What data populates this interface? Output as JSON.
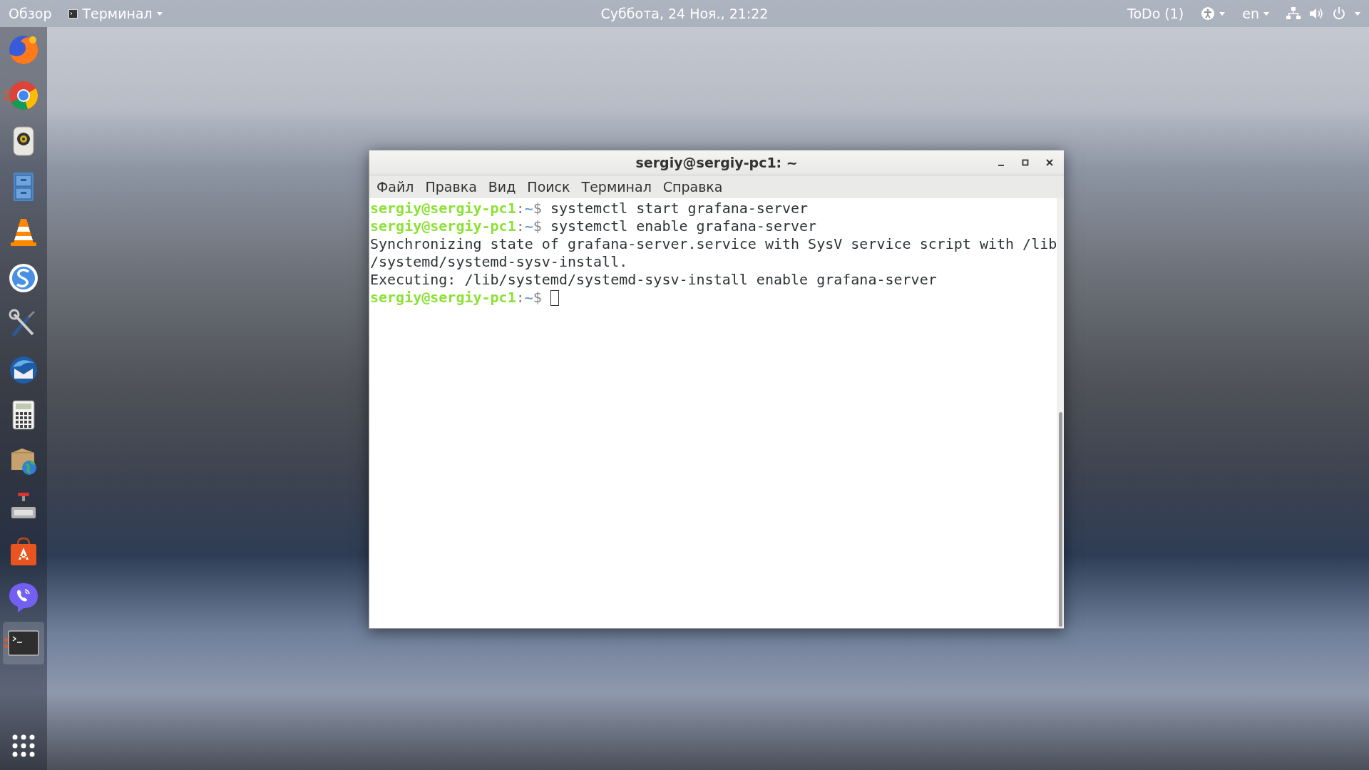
{
  "top_bar": {
    "activities": "Обзор",
    "app_menu": "Терминал",
    "clock": "Суббота, 24 Ноя., 21:22",
    "todo": "ToDo (1)",
    "language": "en"
  },
  "dock": {
    "items": [
      {
        "kind": "globe",
        "running": false,
        "selected": false
      },
      {
        "kind": "ring",
        "running": true,
        "selected": false
      },
      {
        "kind": "speaker",
        "running": false,
        "selected": false
      },
      {
        "kind": "cabinet",
        "running": false,
        "selected": false
      },
      {
        "kind": "cone",
        "running": false,
        "selected": false
      },
      {
        "kind": "swirl",
        "running": false,
        "selected": false
      },
      {
        "kind": "tools",
        "running": false,
        "selected": false
      },
      {
        "kind": "bird",
        "running": false,
        "selected": false
      },
      {
        "kind": "calculator",
        "running": false,
        "selected": false
      },
      {
        "kind": "package",
        "running": false,
        "selected": false
      },
      {
        "kind": "download",
        "running": false,
        "selected": false
      },
      {
        "kind": "bag",
        "running": false,
        "selected": false
      },
      {
        "kind": "phone",
        "running": false,
        "selected": false
      },
      {
        "kind": "terminal",
        "running": true,
        "selected": true
      }
    ]
  },
  "window": {
    "title": "sergiy@sergiy-pc1: ~",
    "menu": [
      "Файл",
      "Правка",
      "Вид",
      "Поиск",
      "Терминал",
      "Справка"
    ],
    "lines": [
      {
        "kind": "prompt",
        "user": "sergiy@sergiy-pc1",
        "sep": ":",
        "path": "~",
        "sign": "$",
        "command": "systemctl start grafana-server"
      },
      {
        "kind": "prompt",
        "user": "sergiy@sergiy-pc1",
        "sep": ":",
        "path": "~",
        "sign": "$",
        "command": "systemctl enable grafana-server"
      },
      {
        "kind": "output",
        "text": "Synchronizing state of grafana-server.service with SysV service script with /lib"
      },
      {
        "kind": "output",
        "text": "/systemd/systemd-sysv-install."
      },
      {
        "kind": "output",
        "text": "Executing: /lib/systemd/systemd-sysv-install enable grafana-server"
      },
      {
        "kind": "prompt",
        "user": "sergiy@sergiy-pc1",
        "sep": ":",
        "path": "~",
        "sign": "$",
        "cursor": true
      }
    ]
  }
}
